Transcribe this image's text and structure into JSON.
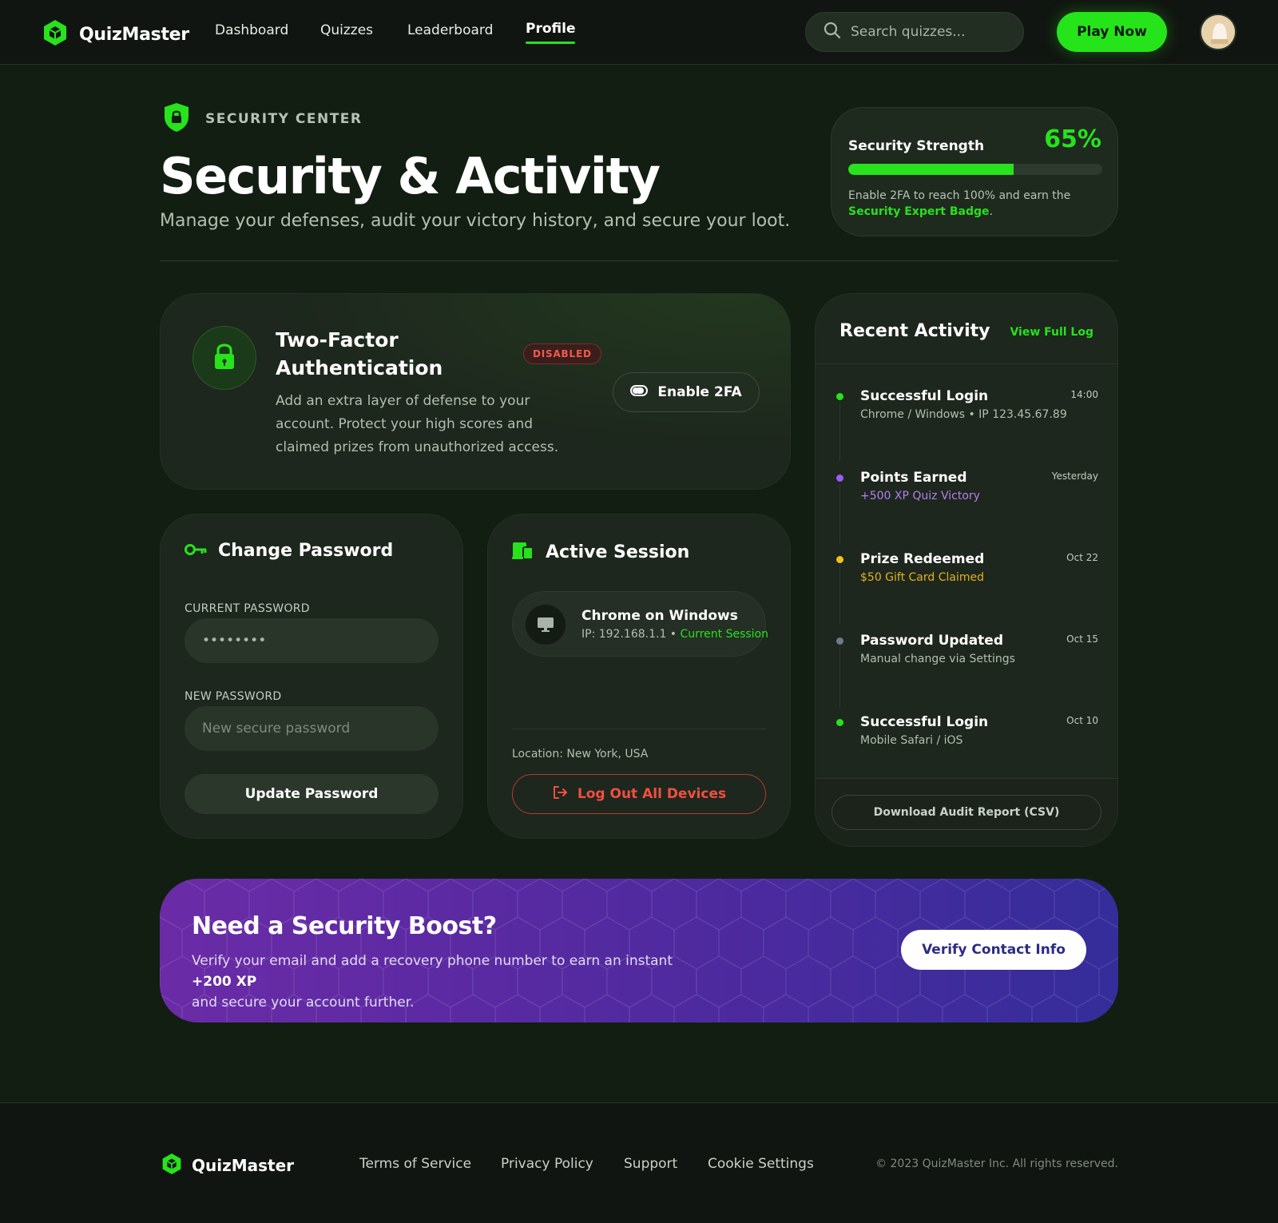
{
  "app": {
    "name": "QuizMaster"
  },
  "nav": {
    "links": [
      "Dashboard",
      "Quizzes",
      "Leaderboard",
      "Profile"
    ],
    "active": "Profile",
    "search_placeholder": "Search quizzes...",
    "play_label": "Play Now"
  },
  "header": {
    "eyebrow": "SECURITY CENTER",
    "title": "Security & Activity",
    "subtitle": "Manage your defenses, audit your victory history, and secure your loot."
  },
  "strength": {
    "title": "Security Strength",
    "percent_label": "65%",
    "percent": 65,
    "desc_prefix": "Enable 2FA to reach 100% and earn the",
    "badge_name": "Security Expert Badge",
    "desc_suffix": "."
  },
  "two_factor": {
    "title": "Two-Factor Authentication",
    "status": "DISABLED",
    "description": "Add an extra layer of defense to your account. Protect your high scores and claimed prizes from unauthorized access.",
    "button": "Enable 2FA"
  },
  "change_password": {
    "title": "Change Password",
    "current_label": "CURRENT PASSWORD",
    "current_value": "••••••••",
    "new_label": "NEW PASSWORD",
    "new_placeholder": "New secure password",
    "button": "Update Password"
  },
  "session": {
    "title": "Active Session",
    "device": "Chrome on Windows",
    "ip": "IP: 192.168.1.1",
    "separator": " • ",
    "current": "Current Session",
    "location": "Location: New York, USA",
    "logout_button": "Log Out All Devices"
  },
  "activity": {
    "title": "Recent Activity",
    "view_link": "View Full Log",
    "items": [
      {
        "title": "Successful Login",
        "detail": "Chrome / Windows • IP 123.45.67.89",
        "time": "14:00",
        "color": "#27e21c",
        "detail_color": "#b2bfb0"
      },
      {
        "title": "Points Earned",
        "detail": "+500 XP Quiz Victory",
        "time": "Yesterday",
        "color": "#9a5cf2",
        "detail_color": "#b47ff2"
      },
      {
        "title": "Prize Redeemed",
        "detail": "$50 Gift Card Claimed",
        "time": "Oct 22",
        "color": "#f2c21c",
        "detail_color": "#e5b21a"
      },
      {
        "title": "Password Updated",
        "detail": "Manual change via Settings",
        "time": "Oct 15",
        "color": "#6f7a8e",
        "detail_color": "#b2bfb0"
      },
      {
        "title": "Successful Login",
        "detail": "Mobile Safari / iOS",
        "time": "Oct 10",
        "color": "#27e21c",
        "detail_color": "#b2bfb0"
      }
    ],
    "download_button": "Download Audit Report (CSV)"
  },
  "boost": {
    "title": "Need a Security Boost?",
    "desc_prefix": "Verify your email and add a recovery phone number to earn an instant",
    "xp": "+200 XP",
    "desc_suffix": "and secure your account further.",
    "button": "Verify Contact Info"
  },
  "footer": {
    "brand": "QuizMaster",
    "links": [
      "Terms of Service",
      "Privacy Policy",
      "Support",
      "Cookie Settings"
    ],
    "copyright": "© 2023 QuizMaster Inc. All rights reserved."
  },
  "colors": {
    "accent": "#27e21c",
    "background": "#121e12",
    "danger": "#f24e40",
    "boost_start": "#6b2ba7",
    "boost_end": "#352d9a"
  },
  "icons": {
    "brand": "cube-logo-icon",
    "search": "search-icon",
    "shield": "shield-lock-icon",
    "lock": "lock-icon",
    "toggle": "toggle-icon",
    "key": "key-icon",
    "devices": "devices-icon",
    "monitor": "monitor-icon",
    "logout": "logout-icon"
  }
}
